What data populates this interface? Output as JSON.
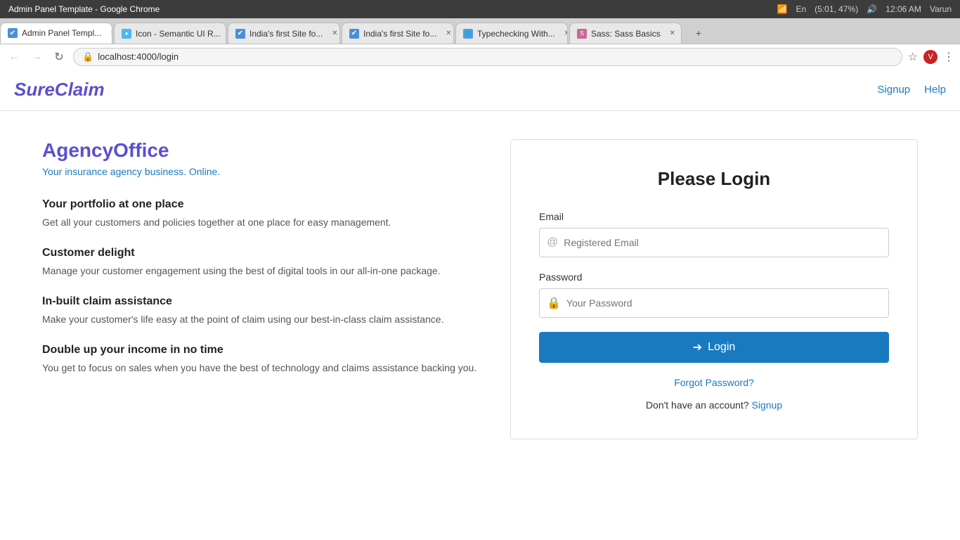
{
  "browser": {
    "title": "Admin Panel Template - Google Chrome",
    "tabs": [
      {
        "label": "Admin Panel Templ...",
        "icon": "✔",
        "icon_bg": "#4a90d9",
        "active": true
      },
      {
        "label": "Icon - Semantic UI R...",
        "icon": "🔵",
        "icon_bg": "#e8e8e8",
        "active": false
      },
      {
        "label": "India's first Site fo...",
        "icon": "✔",
        "icon_bg": "#4a90d9",
        "active": false
      },
      {
        "label": "India's first Site fo...",
        "icon": "✔",
        "icon_bg": "#4a90d9",
        "active": false
      },
      {
        "label": "Typechecking With...",
        "icon": "🌐",
        "icon_bg": "#e8e8e8",
        "active": false
      },
      {
        "label": "Sass: Sass Basics",
        "icon": "💗",
        "icon_bg": "#e8e8e8",
        "active": false
      }
    ],
    "url": "localhost:4000/login",
    "user": "Varun",
    "time": "12:06 AM",
    "battery": "(5:01, 47%)"
  },
  "header": {
    "logo": "SureClaim",
    "nav_signup": "Signup",
    "nav_help": "Help"
  },
  "left": {
    "app_name": "AgencyOffice",
    "tagline_plain": "Your ",
    "tagline_link": "insurance agency business",
    "tagline_end": ". Online.",
    "features": [
      {
        "title": "Your portfolio at one place",
        "desc": "Get all your customers and policies together at one place for easy management."
      },
      {
        "title": "Customer delight",
        "desc": "Manage your customer engagement using the best of digital tools in our all-in-one package."
      },
      {
        "title": "In-built claim assistance",
        "desc": "Make your customer’s life easy at the point of claim using our best-in-class claim assistance."
      },
      {
        "title": "Double up your income in no time",
        "desc": "You get to focus on sales when you have the best of technology and claims assistance backing you."
      }
    ]
  },
  "login": {
    "title": "Please Login",
    "email_label": "Email",
    "email_placeholder": "Registered Email",
    "password_label": "Password",
    "password_placeholder": "Your Password",
    "login_button": "Login",
    "forgot_password": "Forgot Password?",
    "no_account": "Don't have an account?",
    "signup_link": "Signup"
  }
}
